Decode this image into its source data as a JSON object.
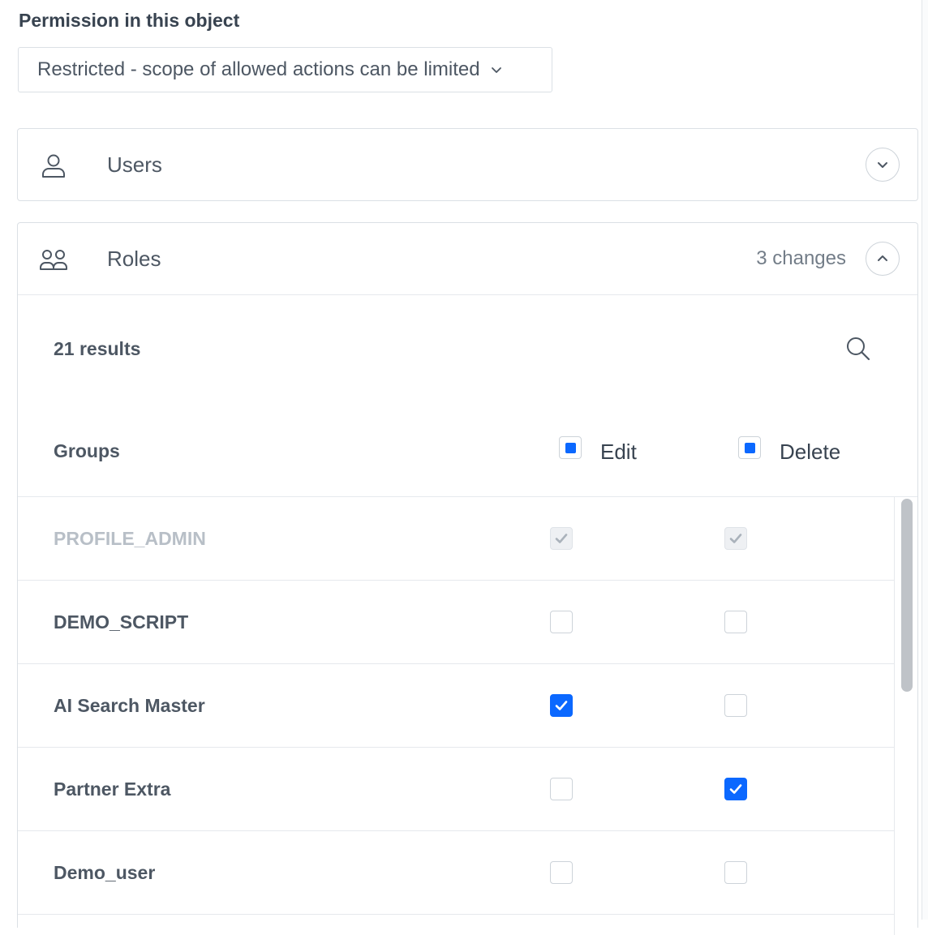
{
  "permission": {
    "label": "Permission in this object",
    "selected": "Restricted - scope of allowed actions can be limited"
  },
  "users": {
    "title": "Users",
    "icon": "user-icon",
    "expanded": false
  },
  "roles": {
    "title": "Roles",
    "icon": "users-icon",
    "changes": "3 changes",
    "expanded": true,
    "results": "21 results",
    "columns": {
      "groups": "Groups",
      "edit": "Edit",
      "delete": "Delete"
    },
    "rows": [
      {
        "name": "PROFILE_ADMIN",
        "edit": "locked",
        "delete": "locked"
      },
      {
        "name": "DEMO_SCRIPT",
        "edit": "unchecked",
        "delete": "unchecked"
      },
      {
        "name": "AI Search Master",
        "edit": "checked",
        "delete": "unchecked"
      },
      {
        "name": "Partner Extra",
        "edit": "unchecked",
        "delete": "checked"
      },
      {
        "name": "Demo_user",
        "edit": "unchecked",
        "delete": "unchecked"
      }
    ]
  },
  "colors": {
    "accent": "#0b68ff",
    "text": "#384350",
    "muted": "#b8bfc7",
    "border": "#dbe0e5"
  }
}
